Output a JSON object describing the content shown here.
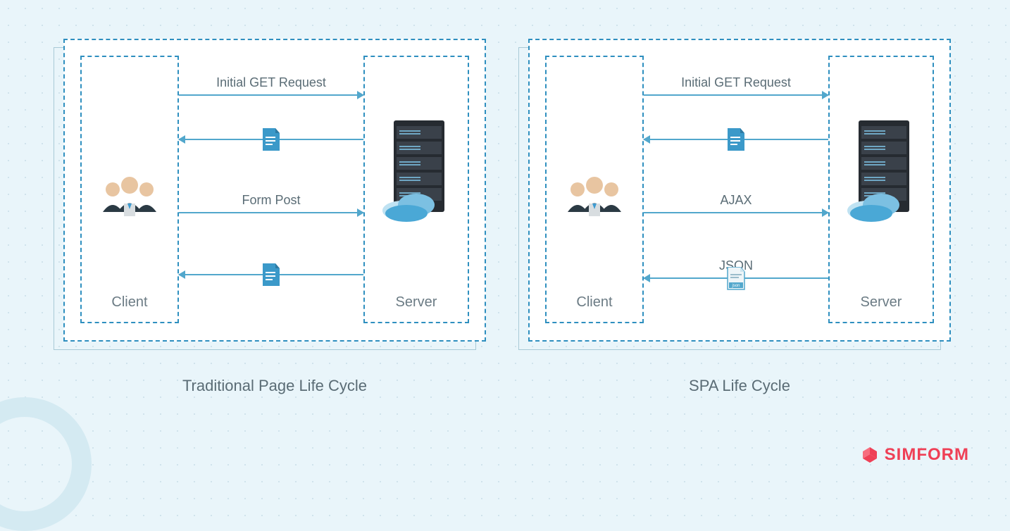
{
  "panels": [
    {
      "caption": "Traditional Page Life Cycle",
      "client_label": "Client",
      "server_label": "Server",
      "flows": [
        {
          "direction": "right",
          "label": "Initial GET Request",
          "payload_icon": null
        },
        {
          "direction": "left",
          "label": "",
          "payload_icon": "doc"
        },
        {
          "direction": "right",
          "label": "Form Post",
          "payload_icon": null
        },
        {
          "direction": "left",
          "label": "",
          "payload_icon": "doc"
        }
      ]
    },
    {
      "caption": "SPA Life Cycle",
      "client_label": "Client",
      "server_label": "Server",
      "flows": [
        {
          "direction": "right",
          "label": "Initial GET Request",
          "payload_icon": null
        },
        {
          "direction": "left",
          "label": "",
          "payload_icon": "doc"
        },
        {
          "direction": "right",
          "label": "AJAX",
          "payload_icon": null
        },
        {
          "direction": "left",
          "label": "JSON",
          "payload_icon": "json"
        }
      ]
    }
  ],
  "brand": "SIMFORM",
  "colors": {
    "accent": "#2e8fbf",
    "arrow": "#52a7cc",
    "text": "#5a6c75",
    "brand": "#ef4056"
  }
}
